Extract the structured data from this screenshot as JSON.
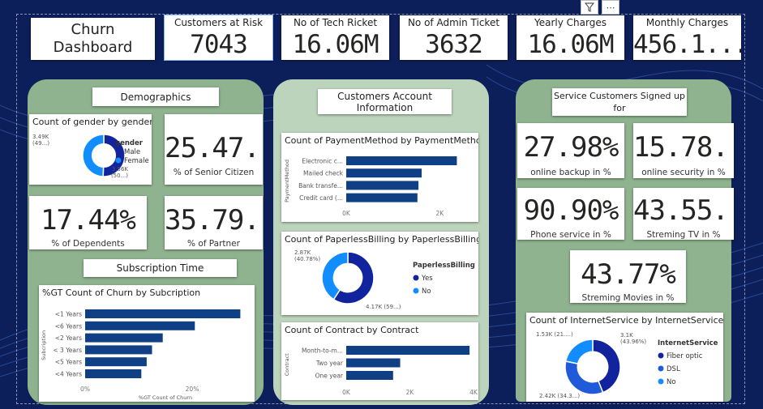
{
  "dashboard": {
    "title": "Churn Dashboard",
    "kpis": [
      {
        "label": "Customers at Risk",
        "value": "7043"
      },
      {
        "label": "No of Tech Ricket",
        "value": "16.06M"
      },
      {
        "label": "No of Admin Ticket",
        "value": "3632"
      },
      {
        "label": "Yearly Charges",
        "value": "16.06M"
      },
      {
        "label": "Monthly Charges",
        "value": "456.1..."
      }
    ]
  },
  "demographics": {
    "title": "Demographics",
    "senior_value": "25.47...",
    "senior_label": "% of Senior Citizen",
    "dependents_value": "17.44%",
    "dependents_label": "% of Dependents",
    "partner_value": "35.79...",
    "partner_label": "% of Partner"
  },
  "subscription": {
    "title": "Subscription Time"
  },
  "account": {
    "title_line1": "Customers Account",
    "title_line2": "Information"
  },
  "services": {
    "title_line1": "Service Customers Signed up",
    "title_line2": "for",
    "backup_value": "27.98%",
    "backup_label": "online backup in %",
    "security_value": "15.78...",
    "security_label": "online security in %",
    "phone_value": "90.90%",
    "phone_label": "Phone service in %",
    "tv_value": "43.55...",
    "tv_label": "Streming TV in %",
    "movies_value": "43.77%",
    "movies_label": "Streming Movies in %"
  },
  "toolbar": {
    "filter_icon": "filter-icon",
    "more_icon": "more-options-icon"
  },
  "colors": {
    "primary": "#12239e",
    "secondary": "#118dff",
    "bar": "#0f3f84",
    "panel": "#8fb38f"
  },
  "chart_data": [
    {
      "id": "gender",
      "type": "pie",
      "title": "Count of gender by gender",
      "legend_title": "gender",
      "slices": [
        {
          "name": "Male",
          "value": 3560,
          "label1": "3.56K",
          "label2": "(50...)",
          "color": "#12239e"
        },
        {
          "name": "Female",
          "value": 3490,
          "label1": "3.49K",
          "label2": "(49...)",
          "color": "#118dff"
        }
      ]
    },
    {
      "id": "subscription",
      "type": "bar",
      "title": "%GT Count of Churn by Subcription",
      "xlabel": "%GT Count of Churn",
      "ylabel": "Subcription",
      "categories": [
        "<1 Years",
        "<6 Years",
        "<2 Years",
        "< 3 Years",
        "<5 Years",
        "<4 Years"
      ],
      "values": [
        29,
        20.5,
        14.5,
        12.5,
        11.5,
        10.5
      ],
      "xlim": [
        0,
        30
      ],
      "ticks": [
        {
          "v": 0,
          "label": "0%"
        },
        {
          "v": 20,
          "label": "20%"
        }
      ]
    },
    {
      "id": "payment",
      "type": "bar",
      "title": "Count of PaymentMethod by PaymentMethod",
      "ylabel": "PaymentMethod",
      "categories": [
        "Electronic c...",
        "Mailed check",
        "Bank transfe...",
        "Credit card (..."
      ],
      "values": [
        2365,
        1612,
        1544,
        1522
      ],
      "xlim": [
        0,
        2600
      ],
      "ticks": [
        {
          "v": 0,
          "label": "0K"
        },
        {
          "v": 2000,
          "label": "2K"
        }
      ]
    },
    {
      "id": "paperless",
      "type": "pie",
      "title": "Count of PaperlessBilling by PaperlessBilling",
      "legend_title": "PaperlessBilling",
      "slices": [
        {
          "name": "Yes",
          "value": 4170,
          "label1": "4.17K (59...)",
          "label2": "",
          "color": "#12239e"
        },
        {
          "name": "No",
          "value": 2870,
          "label1": "2.87K",
          "label2": "(40.78%)",
          "color": "#118dff"
        }
      ]
    },
    {
      "id": "contract",
      "type": "bar",
      "title": "Count of Contract by Contract",
      "ylabel": "Contract",
      "categories": [
        "Month-to-m...",
        "Two year",
        "One year"
      ],
      "values": [
        3875,
        1695,
        1473
      ],
      "xlim": [
        0,
        4000
      ],
      "ticks": [
        {
          "v": 0,
          "label": "0K"
        },
        {
          "v": 2000,
          "label": "2K"
        },
        {
          "v": 4000,
          "label": "4K"
        }
      ]
    },
    {
      "id": "internet",
      "type": "pie",
      "title": "Count of InternetService by InternetService",
      "legend_title": "InternetService",
      "slices": [
        {
          "name": "Fiber optic",
          "value": 3100,
          "label1": "3.1K",
          "label2": "(43.96%)",
          "color": "#12239e"
        },
        {
          "name": "DSL",
          "value": 2420,
          "label1": "2.42K (34.3...)",
          "label2": "",
          "color": "#1f5bd9"
        },
        {
          "name": "No",
          "value": 1530,
          "label1": "1.53K (21....)",
          "label2": "",
          "color": "#118dff"
        }
      ]
    }
  ]
}
